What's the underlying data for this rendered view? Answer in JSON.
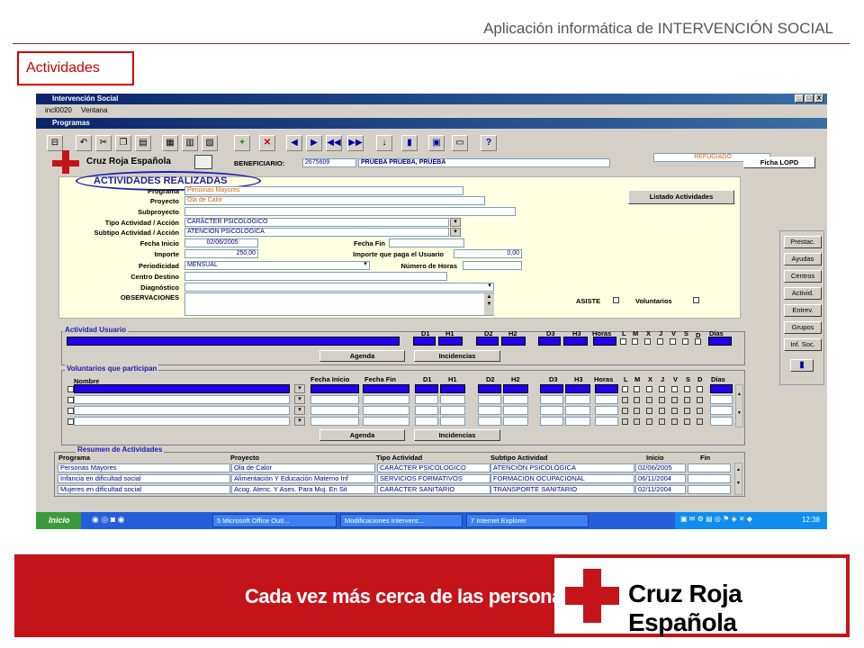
{
  "slide": {
    "title": "Aplicación informática de INTERVENCIÓN SOCIAL",
    "section": "Actividades"
  },
  "window": {
    "title": "Intervención Social",
    "menu": [
      "incl0020",
      "Ventana"
    ],
    "subwindow_title": "Programas",
    "controls": [
      "_",
      "□",
      "X"
    ]
  },
  "header": {
    "org_name": "Cruz Roja Española",
    "beneficiario_label": "BENEFICIARIO:",
    "beneficiario_id": "2675609",
    "beneficiario_name": "PRUEBA PRUEBA, PRUEBA",
    "status": "REFUGIADO",
    "lopd_button": "Ficha LOPD"
  },
  "form": {
    "section_title": "ACTIVIDADES REALIZADAS",
    "programa_label": "Programa",
    "programa_value": "Personas Mayores",
    "proyecto_label": "Proyecto",
    "proyecto_value": "Ola de Calor",
    "subproyecto_label": "Subproyecto",
    "subproyecto_value": "",
    "tipo_label": "Tipo Actividad / Acción",
    "tipo_value": "CARÁCTER PSICOLOGICO",
    "subtipo_label": "Subtipo Actividad / Acción",
    "subtipo_value": "ATENCIÓN PSICOLÓGICA",
    "fecha_inicio_label": "Fecha Inicio",
    "fecha_inicio_value": "02/06/2005",
    "fecha_fin_label": "Fecha Fin",
    "fecha_fin_value": "",
    "importe_label": "Importe",
    "importe_value": "250,00",
    "importe_usuario_label": "Importe que paga el Usuario",
    "importe_usuario_value": "0,00",
    "periodicidad_label": "Periodicidad",
    "periodicidad_value": "MENSUAL",
    "num_horas_label": "Número de Horas",
    "num_horas_value": "",
    "centro_destino_label": "Centro Destino",
    "diagnostico_label": "Diagnóstico",
    "observaciones_label": "OBSERVACIONES",
    "asiste_label": "ASISTE",
    "voluntarios_label": "Voluntarios",
    "listado_button": "Listado Actividades"
  },
  "side_buttons": [
    "Prestac.",
    "Ayudas",
    "Centros",
    "Activid.",
    "Entrev.",
    "Grupos",
    "Inf. Soc."
  ],
  "actividad_usuario": {
    "title": "Actividad Usuario",
    "headers": [
      "D1",
      "H1",
      "D2",
      "H2",
      "D3",
      "H3",
      "Horas",
      "L",
      "M",
      "X",
      "J",
      "V",
      "S",
      "D",
      "Días"
    ],
    "agenda_button": "Agenda",
    "incidencias_button": "Incidencias"
  },
  "voluntarios": {
    "title": "Voluntarios que participan",
    "nombre_header": "Nombre",
    "fecha_inicio_header": "Fecha Inicio",
    "fecha_fin_header": "Fecha Fin",
    "headers": [
      "D1",
      "H1",
      "D2",
      "H2",
      "D3",
      "H3",
      "Horas",
      "L",
      "M",
      "X",
      "J",
      "V",
      "S",
      "D",
      "Días"
    ],
    "agenda_button": "Agenda",
    "incidencias_button": "Incidencias"
  },
  "resumen": {
    "title": "Resumen de Actividades",
    "columns": [
      "Programa",
      "Proyecto",
      "Tipo Actividad",
      "Subtipo Actividad",
      "Inicio",
      "Fin"
    ],
    "rows": [
      [
        "Personas Mayores",
        "Ola de Calor",
        "CARÁCTER PSICOLOGICO",
        "ATENCIÓN PSICOLÓGICA",
        "02/06/2005",
        ""
      ],
      [
        "Infancia en dificultad social",
        "Alimentación Y Educación Materno Inf",
        "SERVICIOS FORMATIVOS",
        "FORMACION OCUPACIONAL",
        "06/11/2004",
        ""
      ],
      [
        "Mujeres en dificultad social",
        "Acog. Atenc. Y Ases. Para Muj. En Sit",
        "CARÁCTER SANITARIO",
        "TRANSPORTE SANITARIO",
        "02/11/2004",
        ""
      ]
    ]
  },
  "taskbar": {
    "start": "Inicio",
    "tasks": [
      "5 Microsoft Office Outl...",
      "Modificaciones Intervenc...",
      "7 Internet Explorer"
    ],
    "clock": "12:38"
  },
  "banner": {
    "slogan": "Cada vez más cerca de las personas",
    "brand": "Cruz Roja Española"
  },
  "colors": {
    "cruz_red": "#c4141a",
    "xp_blue": "#245edb",
    "form_bg": "#ffffe1",
    "blue_field": "#2200ee"
  }
}
